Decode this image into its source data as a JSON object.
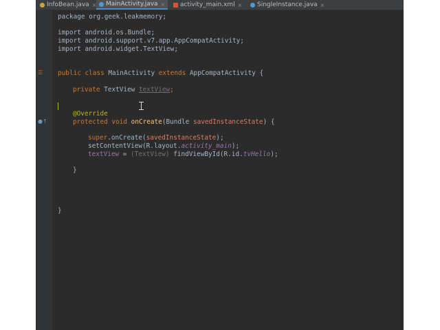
{
  "tabs": [
    {
      "label": "InfoBean.java",
      "close": "×",
      "active": false
    },
    {
      "label": "MainActivity.java",
      "close": "×",
      "active": true
    },
    {
      "label": "activity_main.xml",
      "close": "×",
      "active": false
    },
    {
      "label": "SingleInstance.java",
      "close": "×",
      "active": false
    }
  ],
  "code": {
    "l1": {
      "a": "package org.geek.leakmemory;"
    },
    "l2": {
      "a": "import android.os.Bundle;"
    },
    "l3": {
      "a": "import android.support.v7.app.AppCompatActivity;"
    },
    "l4": {
      "a": "import android.widget.TextView;"
    },
    "l5": {
      "kw": "public class ",
      "name": "MainActivity ",
      "kw2": "extends ",
      "sup": "AppCompatActivity {"
    },
    "l6": {
      "kw": "private ",
      "type": "TextView ",
      "field": "textView",
      "end": ";"
    },
    "l7": {
      "ann": "@Override"
    },
    "l8": {
      "kw": "protected void ",
      "mth": "onCreate",
      "p1": "(Bundle ",
      "param": "savedInstanceState",
      "p2": ") {"
    },
    "l9": {
      "kw": "super",
      "a": ".onCreate(",
      "param": "savedInstanceState",
      "b": ");"
    },
    "l10": {
      "a": "setContentView(R.layout.",
      "stat": "activity_main",
      "b": ");"
    },
    "l11": {
      "field": "textView",
      "a": " = ",
      "cast": "(TextView) ",
      "b": "findViewById(R.id.",
      "stat": "tvHello",
      "c": ");"
    },
    "l12": {
      "a": "}"
    },
    "l13": {
      "a": "}"
    }
  },
  "colors": {
    "editor_bg": "#2b2b2b",
    "keyword": "#cc7832",
    "annotation": "#bbb529",
    "method": "#ffc66d",
    "field": "#9876aa"
  }
}
